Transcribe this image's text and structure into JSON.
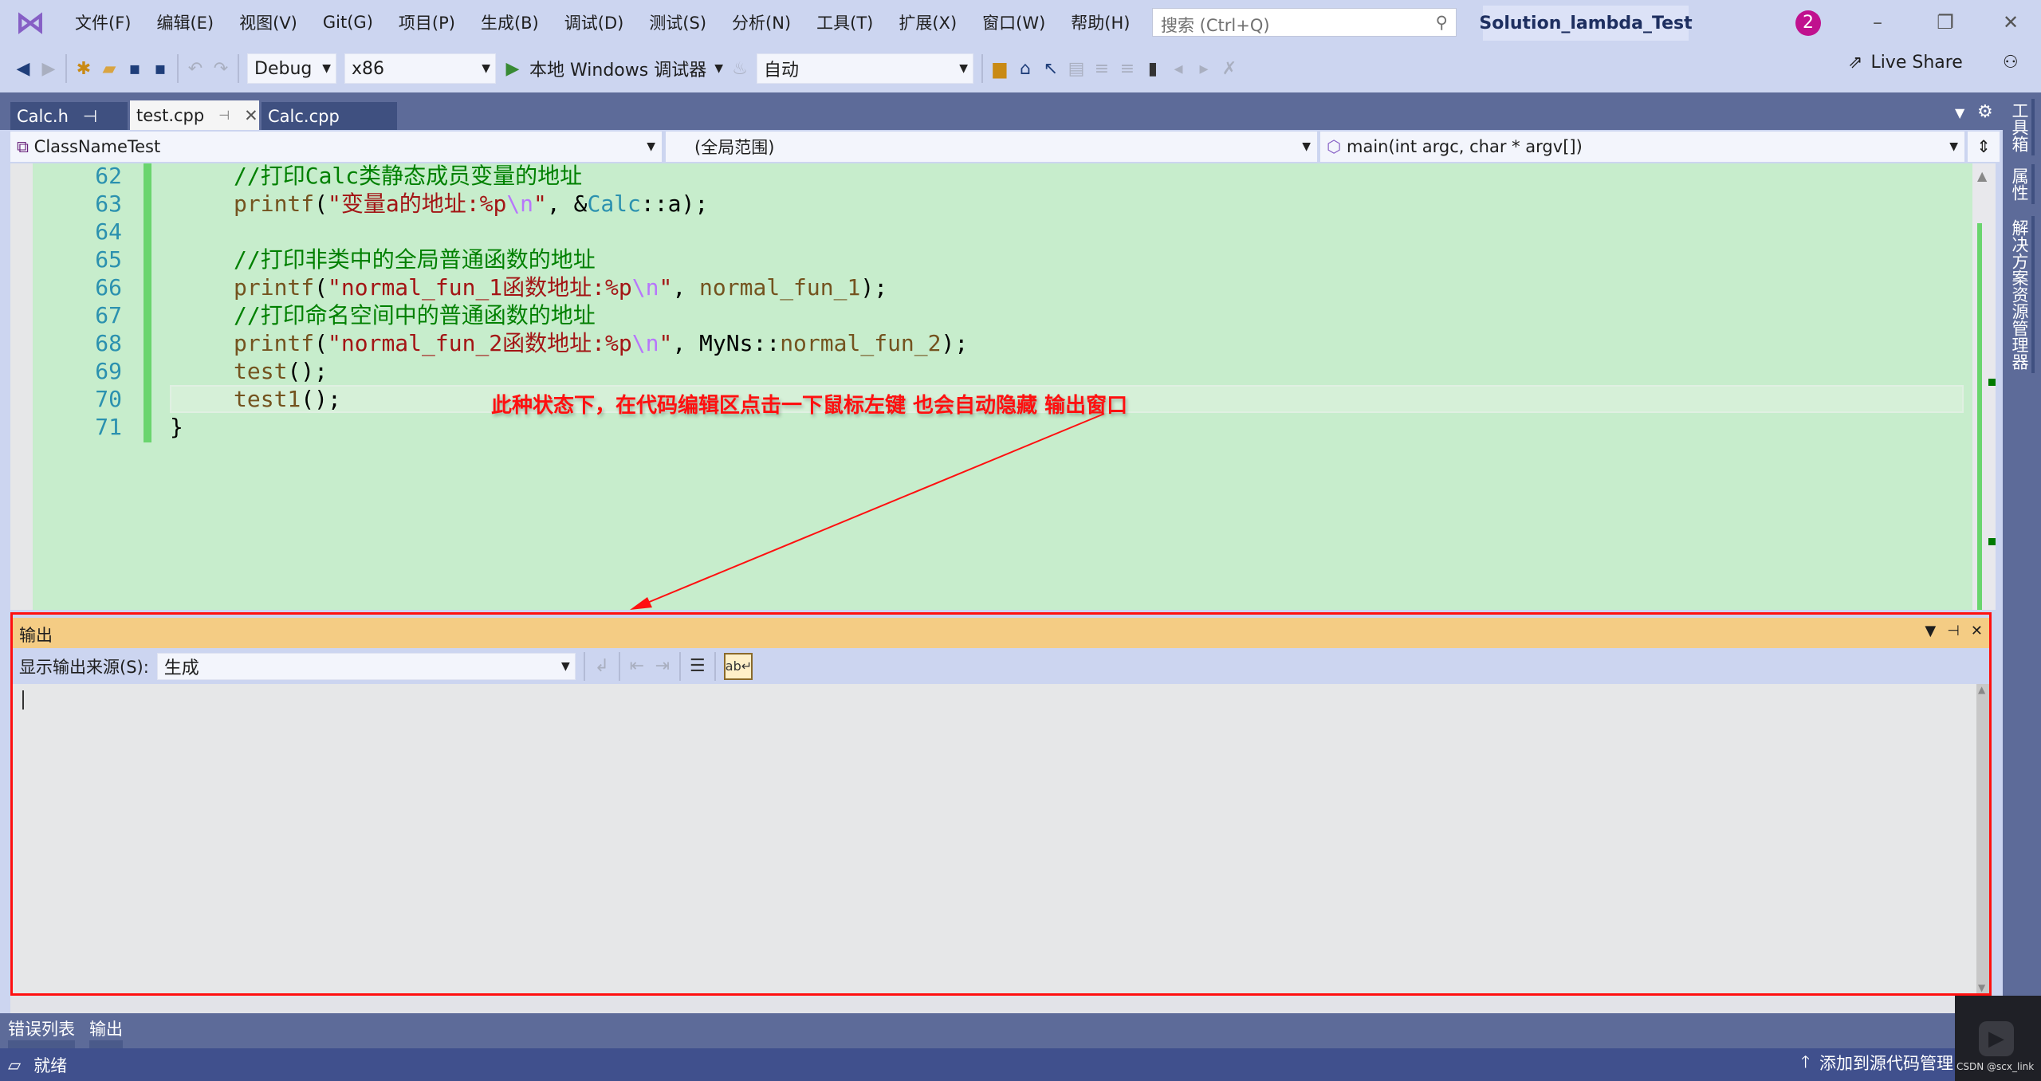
{
  "menubar": {
    "items": [
      "文件(F)",
      "编辑(E)",
      "视图(V)",
      "Git(G)",
      "项目(P)",
      "生成(B)",
      "调试(D)",
      "测试(S)",
      "分析(N)",
      "工具(T)",
      "扩展(X)",
      "窗口(W)",
      "帮助(H)"
    ],
    "search_placeholder": "搜索 (Ctrl+Q)",
    "solution": "Solution_lambda_Test",
    "notifications": "2"
  },
  "toolbar": {
    "config": "Debug",
    "platform": "x86",
    "run_label": "本地 Windows 调试器",
    "auto": "自动",
    "live_share": "Live Share"
  },
  "tabs": [
    {
      "label": "Calc.h",
      "pin": "⊣"
    },
    {
      "label": "test.cpp",
      "pin": "⊣",
      "close": "✕"
    },
    {
      "label": "Calc.cpp"
    }
  ],
  "navbar": {
    "project": "ClassNameTest",
    "scope": "(全局范围)",
    "member": "main(int argc, char * argv[])"
  },
  "editor": {
    "lines": [
      {
        "n": "62",
        "tokens": [
          {
            "t": "//打印Calc类静态成员变量的地址",
            "c": "cm"
          }
        ]
      },
      {
        "n": "63",
        "tokens": [
          {
            "t": "printf",
            "c": "fn"
          },
          {
            "t": "(",
            "c": "pn"
          },
          {
            "t": "\"变量a的地址:%p",
            "c": "str"
          },
          {
            "t": "\\n",
            "c": "esc"
          },
          {
            "t": "\"",
            "c": "str"
          },
          {
            "t": ", &",
            "c": "pn"
          },
          {
            "t": "Calc",
            "c": "ty"
          },
          {
            "t": "::a);",
            "c": "pn"
          }
        ]
      },
      {
        "n": "64",
        "tokens": []
      },
      {
        "n": "65",
        "tokens": [
          {
            "t": "//打印非类中的全局普通函数的地址",
            "c": "cm"
          }
        ]
      },
      {
        "n": "66",
        "tokens": [
          {
            "t": "printf",
            "c": "fn"
          },
          {
            "t": "(",
            "c": "pn"
          },
          {
            "t": "\"normal_fun_1函数地址:%p",
            "c": "str"
          },
          {
            "t": "\\n",
            "c": "esc"
          },
          {
            "t": "\"",
            "c": "str"
          },
          {
            "t": ", ",
            "c": "pn"
          },
          {
            "t": "normal_fun_1",
            "c": "fn"
          },
          {
            "t": ");",
            "c": "pn"
          }
        ]
      },
      {
        "n": "67",
        "tokens": [
          {
            "t": "//打印命名空间中的普通函数的地址",
            "c": "cm"
          }
        ]
      },
      {
        "n": "68",
        "tokens": [
          {
            "t": "printf",
            "c": "fn"
          },
          {
            "t": "(",
            "c": "pn"
          },
          {
            "t": "\"normal_fun_2函数地址:%p",
            "c": "str"
          },
          {
            "t": "\\n",
            "c": "esc"
          },
          {
            "t": "\"",
            "c": "str"
          },
          {
            "t": ", ",
            "c": "pn"
          },
          {
            "t": "MyNs",
            "c": "ns"
          },
          {
            "t": "::",
            "c": "pn"
          },
          {
            "t": "normal_fun_2",
            "c": "fn"
          },
          {
            "t": ");",
            "c": "pn"
          }
        ]
      },
      {
        "n": "69",
        "tokens": [
          {
            "t": "test",
            "c": "fn"
          },
          {
            "t": "();",
            "c": "pn"
          }
        ]
      },
      {
        "n": "70",
        "tokens": [
          {
            "t": "test1",
            "c": "fn"
          },
          {
            "t": "();",
            "c": "pn"
          }
        ]
      },
      {
        "n": "71",
        "tokens": [
          {
            "t": "}",
            "c": "pn"
          }
        ],
        "outdent": true
      }
    ],
    "current_line": "70"
  },
  "annotation": "此种状态下，在代码编辑区点击一下鼠标左键 也会自动隐藏 输出窗口",
  "output": {
    "title": "输出",
    "source_label": "显示输出来源(S):",
    "source_value": "生成"
  },
  "right_panel": [
    "工具箱",
    "属性",
    "解决方案资源管理器"
  ],
  "bottom_tabs": [
    "错误列表",
    "输出"
  ],
  "status": {
    "ready": "就绪",
    "source_control": "添加到源代码管理"
  },
  "watermark": "CSDN @scx_link",
  "colors": {
    "editor_bg": "#C7EDCC",
    "output_header": "#F4CC84",
    "status_bar": "#40508D",
    "annotation": "#FF1010"
  }
}
